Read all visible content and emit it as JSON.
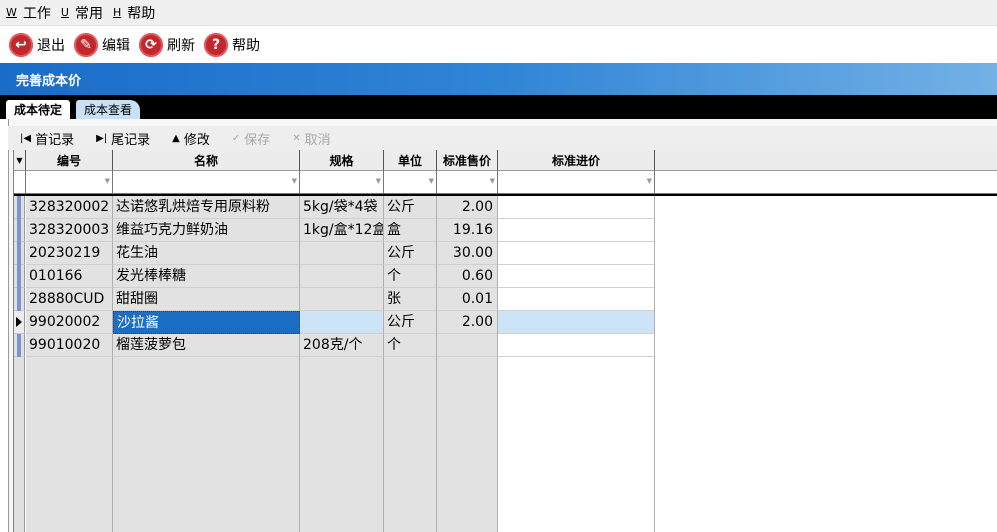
{
  "menu": {
    "items": [
      {
        "mnemonic": "W",
        "label": "工作"
      },
      {
        "mnemonic": "U",
        "label": "常用"
      },
      {
        "mnemonic": "H",
        "label": "帮助"
      }
    ]
  },
  "toolbar": {
    "buttons": [
      {
        "label": "退出",
        "glyph": "↩",
        "icon": "exit-icon"
      },
      {
        "label": "编辑",
        "glyph": "✎",
        "icon": "edit-icon"
      },
      {
        "label": "刷新",
        "glyph": "⟳",
        "icon": "refresh-icon"
      },
      {
        "label": "帮助",
        "glyph": "?",
        "icon": "help-icon"
      }
    ]
  },
  "window": {
    "title": "完善成本价"
  },
  "tabs": [
    {
      "label": "成本待定",
      "active": true
    },
    {
      "label": "成本查看",
      "active": false
    }
  ],
  "nav": {
    "first": "首记录",
    "last": "尾记录",
    "edit": "修改",
    "save": "保存",
    "cancel": "取消"
  },
  "grid": {
    "columns": [
      "编号",
      "名称",
      "规格",
      "单位",
      "标准售价",
      "标准进价"
    ],
    "rows": [
      {
        "code": "328320002",
        "name": "达诺悠乳烘焙专用原料粉",
        "spec": "5kg/袋*4袋",
        "unit": "公斤",
        "price": "2.00",
        "cost": ""
      },
      {
        "code": "328320003",
        "name": "维益巧克力鲜奶油",
        "spec": "1kg/盒*12盒",
        "unit": "盒",
        "price": "19.16",
        "cost": ""
      },
      {
        "code": "20230219",
        "name": "花生油",
        "spec": "",
        "unit": "公斤",
        "price": "30.00",
        "cost": ""
      },
      {
        "code": "010166",
        "name": "发光棒棒糖",
        "spec": "",
        "unit": "个",
        "price": "0.60",
        "cost": ""
      },
      {
        "code": "28880CUD",
        "name": "甜甜圈",
        "spec": "",
        "unit": "张",
        "price": "0.01",
        "cost": ""
      },
      {
        "code": "99020002",
        "name": "沙拉酱",
        "spec": "",
        "unit": "公斤",
        "price": "2.00",
        "cost": ""
      },
      {
        "code": "99010020",
        "name": "榴莲菠萝包",
        "spec": "208克/个",
        "unit": "个",
        "price": "",
        "cost": ""
      }
    ],
    "selected_row": 5
  },
  "colors": {
    "title_bar_start": "#1a6cc9",
    "title_bar_end": "#73b1e6",
    "selection": "#1c6ec4",
    "row_highlight": "#cde4f7",
    "toolbar_icon": "#c0282d"
  }
}
